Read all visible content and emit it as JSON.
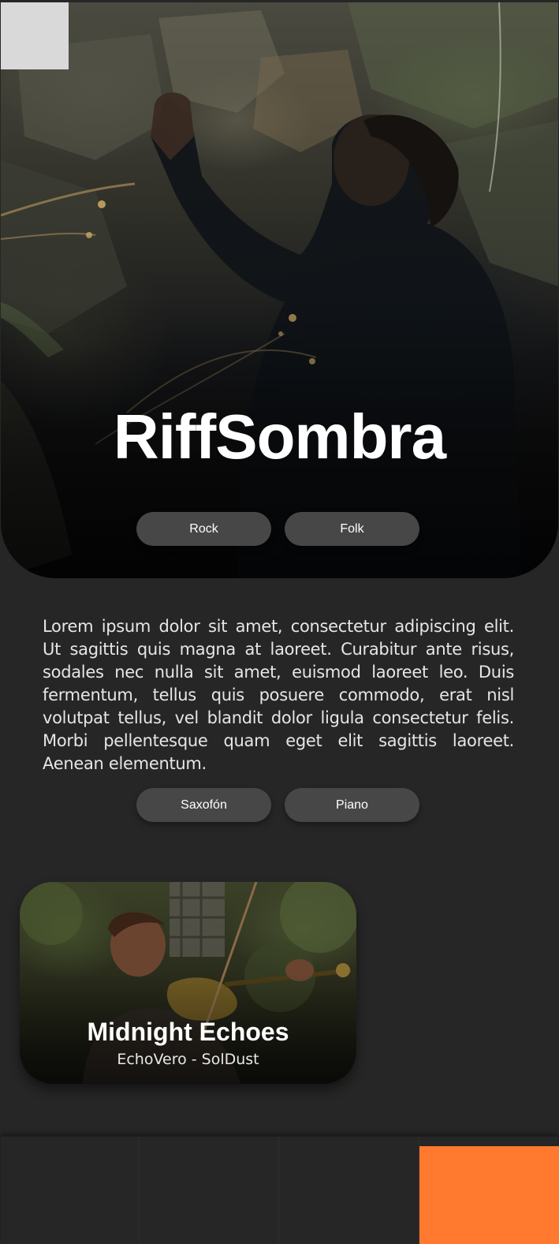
{
  "artist": {
    "name": "RiffSombra",
    "genres": [
      "Rock",
      "Folk"
    ]
  },
  "description": "Lorem ipsum dolor sit amet, consectetur adipiscing elit. Ut sagittis quis magna at laoreet. Curabitur ante risus, sodales nec nulla sit amet, euismod laoreet leo. Duis fermentum, tellus quis posuere commodo, erat nisl volutpat tellus, vel blandit dolor ligula consectetur felis. Morbi pellentesque quam eget elit sagittis laoreet. Aenean elementum.",
  "instruments": [
    "Saxofón",
    "Piano"
  ],
  "song": {
    "title": "Midnight Echoes",
    "artists": "EchoVero - SolDust"
  },
  "colors": {
    "background": "#262626",
    "pill": "#474747",
    "accent": "#ff7a2f",
    "placeholder": "#d9d9d9"
  },
  "bottom_nav": {
    "active_index": 3,
    "slot_count": 4
  }
}
